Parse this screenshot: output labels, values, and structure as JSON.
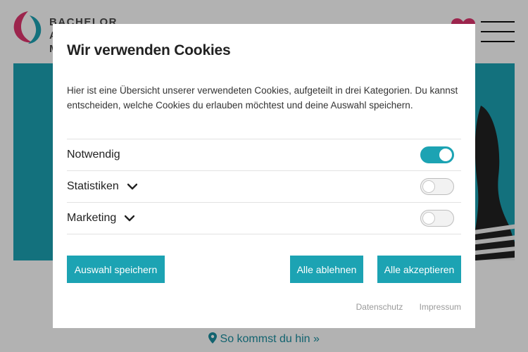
{
  "background": {
    "logo_text": "BACHELOR",
    "logo_text_line2": "A",
    "logo_text_line3": "M",
    "find_us": "So kommst du hin »",
    "colors": {
      "teal": "#1ca3b3",
      "heart": "#e0366f"
    }
  },
  "modal": {
    "title": "Wir verwenden Cookies",
    "description": "Hier ist eine Übersicht unserer verwendeten Cookies, aufgeteilt in drei Kategorien. Du kannst entscheiden, welche Cookies du erlauben möchtest und deine Auswahl speichern.",
    "categories": [
      {
        "label": "Notwendig",
        "enabled": true,
        "expandable": false
      },
      {
        "label": "Statistiken",
        "enabled": false,
        "expandable": true
      },
      {
        "label": "Marketing",
        "enabled": false,
        "expandable": true
      }
    ],
    "buttons": {
      "save": "Auswahl speichern",
      "reject_all": "Alle ablehnen",
      "accept_all": "Alle akzeptieren"
    },
    "links": {
      "privacy": "Datenschutz",
      "imprint": "Impressum"
    }
  }
}
